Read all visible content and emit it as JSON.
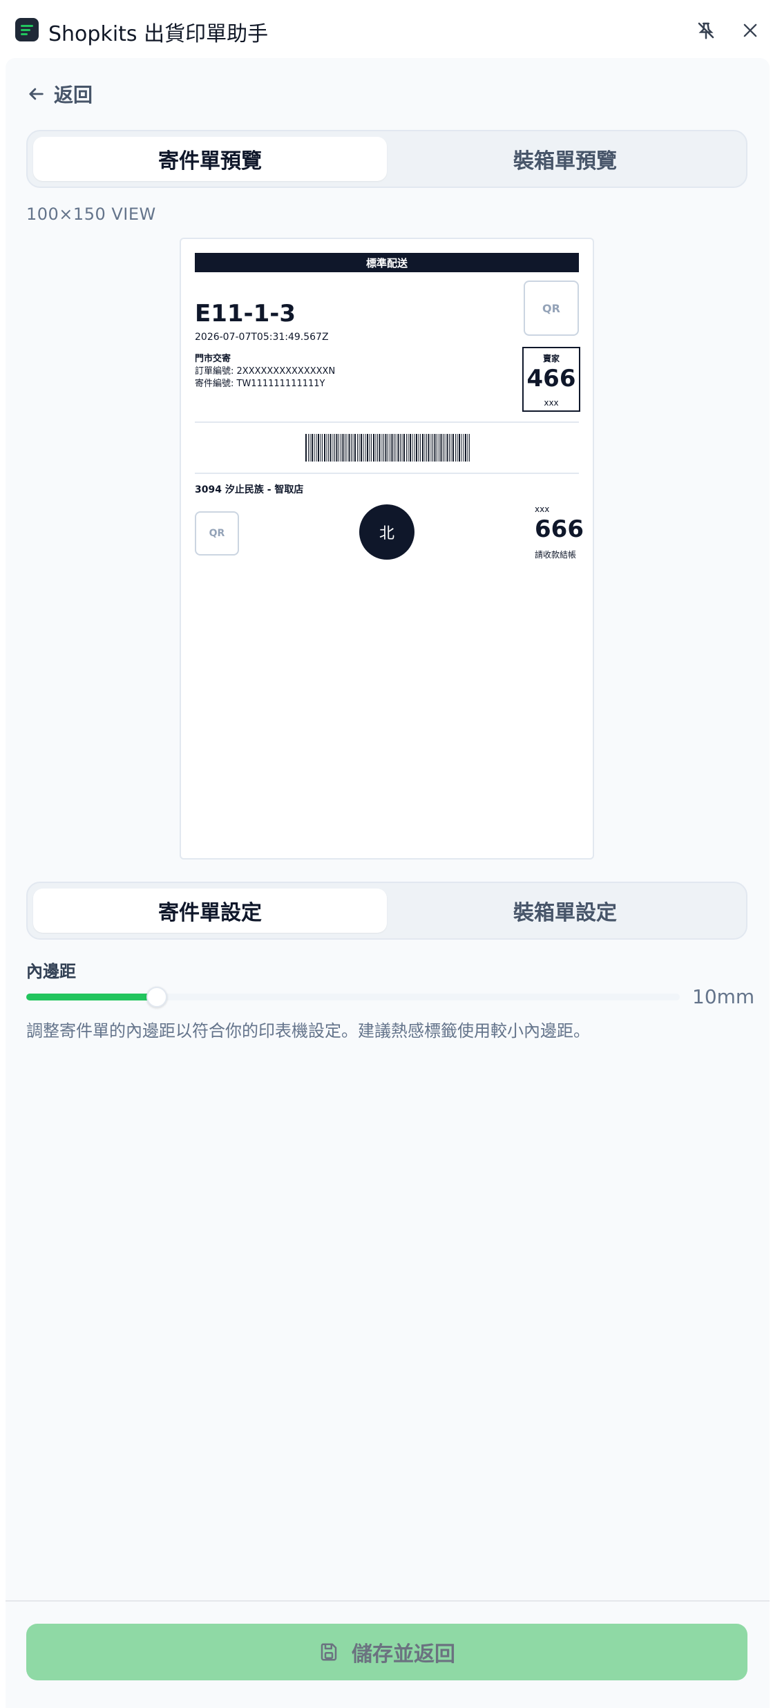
{
  "app": {
    "title": "Shopkits 出貨印單助手"
  },
  "nav": {
    "back_label": "返回"
  },
  "preview_tabs": [
    {
      "label": "寄件單預覽",
      "active": true
    },
    {
      "label": "裝箱單預覽",
      "active": false
    }
  ],
  "view_label": "100×150 VIEW",
  "label_preview": {
    "header": "標準配送",
    "code": "E11-1-3",
    "timestamp": "2026-07-07T05:31:49.567Z",
    "method": "門市交寄",
    "order_no": "訂單編號: 2XXXXXXXXXXXXXXN",
    "ship_no": "寄件編號: TW111111111111Y",
    "qr_label": "QR",
    "seller_title": "賣家",
    "seller_number": "466",
    "seller_sub": "xxx",
    "store": "3094 汐止民族 - 智取店",
    "region": "北",
    "small_code": "xxx",
    "amount": "666",
    "collect": "請收款結帳"
  },
  "settings_tabs": [
    {
      "label": "寄件單設定",
      "active": true
    },
    {
      "label": "裝箱單設定",
      "active": false
    }
  ],
  "padding": {
    "title": "內邊距",
    "value": "10mm",
    "fraction": 0.2,
    "description": "調整寄件單的內邊距以符合你的印表機設定。建議熱感標籤使用較小內邊距。"
  },
  "footer": {
    "save_label": "儲存並返回"
  },
  "colors": {
    "accent": "#22c55e",
    "dark": "#0f172a",
    "save_bg": "#8fd9a5"
  },
  "icons": [
    "app-icon",
    "unpin-icon",
    "close-icon",
    "arrow-left-icon",
    "save-icon"
  ]
}
